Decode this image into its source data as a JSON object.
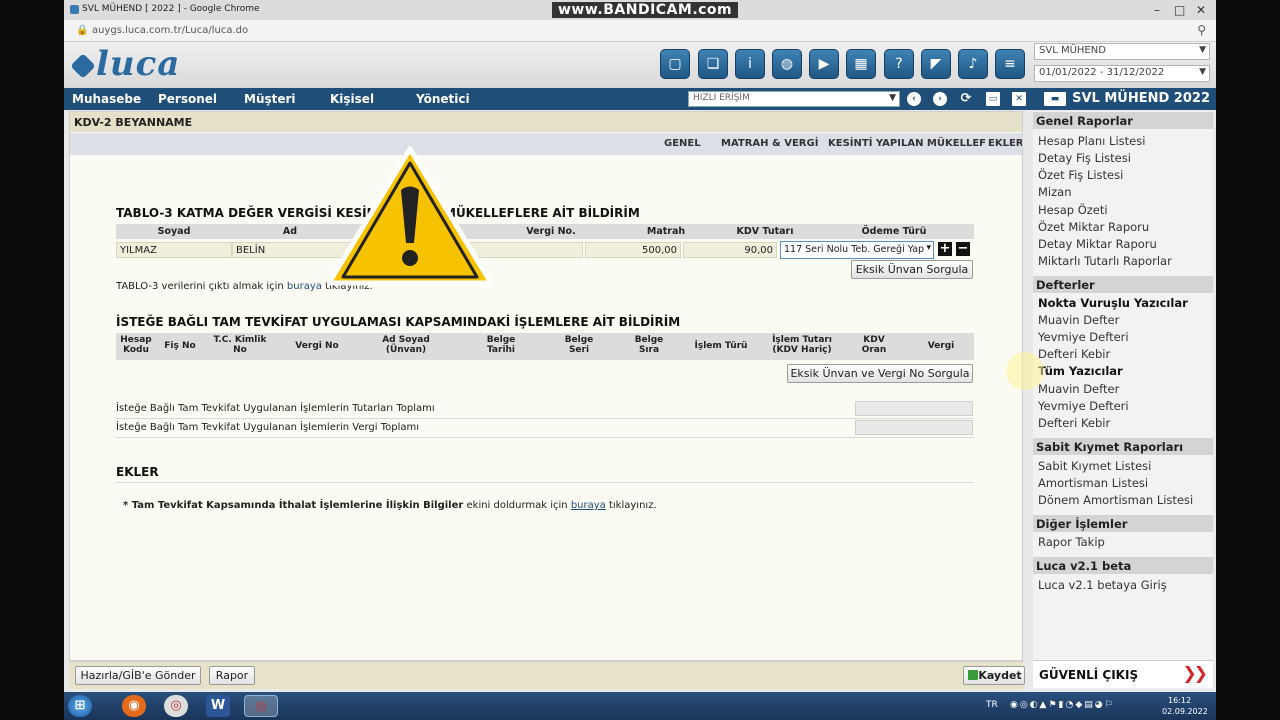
{
  "browser": {
    "tab_title": "SVL MÜHEND [ 2022 ] - Google Chrome",
    "watermark": "www.BANDICAM.com",
    "url": "auygs.luca.com.tr/Luca/luca.do"
  },
  "header": {
    "logo": "luca",
    "company_select": "SVL MÜHEND",
    "period_select": "01/01/2022 - 31/12/2022"
  },
  "menu": {
    "items": [
      "Muhasebe",
      "Personel",
      "Müşteri",
      "Kişisel",
      "Yönetici"
    ],
    "quick_access_placeholder": "HIZLI ERİŞİM",
    "company_label": "SVL MÜHEND 2022"
  },
  "page": {
    "title": "KDV-2 BEYANNAME",
    "tabs": [
      "GENEL",
      "MATRAH & VERGİ",
      "KESİNTİ YAPILAN MÜKELLEF",
      "EKLER"
    ]
  },
  "table3": {
    "title_left": "TABLO-3 KATMA DEĞER VERGİSİ KESİN",
    "title_right": "MÜKELLEFLERE AİT BİLDİRİM",
    "headers": [
      "Soyad",
      "Ad",
      "Vergi No.",
      "Matrah",
      "KDV Tutarı",
      "Ödeme Türü"
    ],
    "row": {
      "soyad": "YILMAZ",
      "ad": "BELİN",
      "vergi_no": "",
      "matrah": "500,00",
      "kdv_tutari": "90,00",
      "odeme_turu": "117 Seri Nolu Teb. Gereği Yap"
    },
    "query_button": "Eksik Ünvan Sorgula",
    "output_note_before": "TABLO-3 verilerini çıktı almak için",
    "output_link": "buraya",
    "output_note_after": "tıklayınız."
  },
  "tevkifat": {
    "title": "İSTEĞE BAĞLI TAM TEVKİFAT UYGULAMASI KAPSAMINDAKİ İŞLEMLERE AİT BİLDİRİM",
    "headers": [
      "Hesap Kodu",
      "Fiş No",
      "T.C. Kimlik No",
      "Vergi No",
      "Ad Soyad (Ünvan)",
      "Belge Tarihi",
      "Belge Seri",
      "Belge Sıra",
      "İşlem Türü",
      "İşlem Tutarı (KDV Hariç)",
      "KDV Oran",
      "Vergi"
    ],
    "query_button": "Eksik Ünvan ve Vergi No Sorgula",
    "total_amount_label": "İsteğe Bağlı Tam Tevkifat Uygulanan İşlemlerin Tutarları Toplamı",
    "total_tax_label": "İsteğe Bağlı Tam Tevkifat Uygulanan İşlemlerin Vergi Toplamı"
  },
  "ekler": {
    "title": "EKLER",
    "note_bold": "* Tam Tevkifat Kapsamında İthalat İşlemlerine İlişkin Bilgiler",
    "note_mid": "ekini doldurmak için",
    "note_link": "buraya",
    "note_end": "tıklayınız."
  },
  "bottom": {
    "send_button": "Hazırla/GİB'e Gönder",
    "report_button": "Rapor",
    "save_button": "Kaydet"
  },
  "sidebar": {
    "sections": [
      {
        "title": "Genel Raporlar",
        "items": [
          "Hesap Planı Listesi",
          "Detay Fiş Listesi",
          "Özet Fiş Listesi",
          "Mizan",
          "Hesap Özeti",
          "Özet Miktar Raporu",
          "Detay Miktar Raporu",
          "Miktarlı Tutarlı Raporlar"
        ]
      },
      {
        "title": "Defterler",
        "items": [
          "Nokta Vuruşlu Yazıcılar",
          "Muavin Defter",
          "Yevmiye Defteri",
          "Defteri Kebir",
          "Tüm Yazıcılar",
          "Muavin Defter",
          "Yevmiye Defteri",
          "Defteri Kebir"
        ]
      },
      {
        "title": "Sabit Kıymet Raporları",
        "items": [
          "Sabit Kıymet Listesi",
          "Amortisman Listesi",
          "Dönem Amortisman Listesi"
        ]
      },
      {
        "title": "Diğer İşlemler",
        "items": [
          "Rapor Takip"
        ]
      },
      {
        "title": "Luca v2.1 beta",
        "items": [
          "Luca v2.1 betaya Giriş"
        ]
      }
    ],
    "exit_label": "GÜVENLİ ÇIKIŞ"
  },
  "taskbar": {
    "lang": "TR",
    "time": "16:12",
    "date": "02.09.2022"
  },
  "colors": {
    "menu_bg": "#1f4f78",
    "page_head_bg": "#e4e1c8",
    "exit_arrow": "#d2262c",
    "warning_yellow": "#f7c300"
  }
}
